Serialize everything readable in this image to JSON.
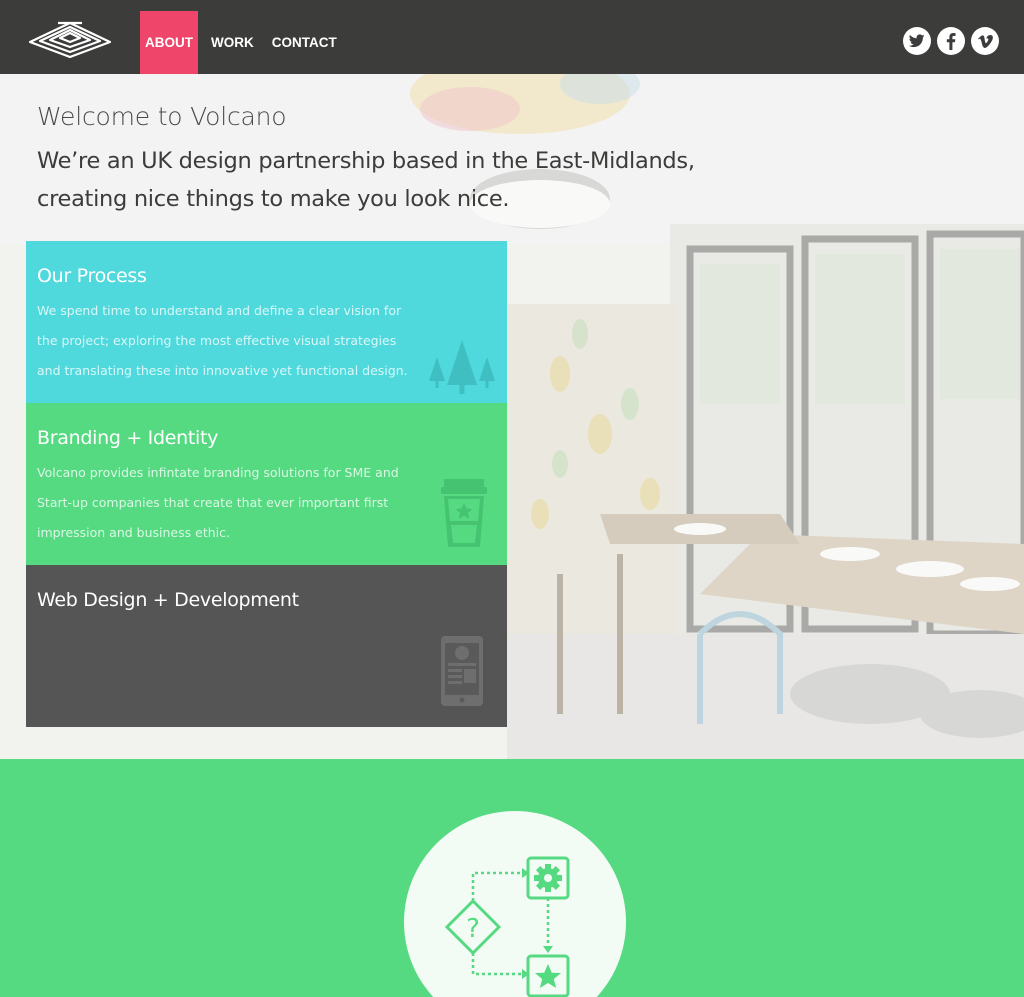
{
  "nav": {
    "items": [
      {
        "label": "ABOUT",
        "active": true
      },
      {
        "label": "WORK",
        "active": false
      },
      {
        "label": "CONTACT",
        "active": false
      }
    ]
  },
  "social": [
    "twitter-icon",
    "facebook-icon",
    "vimeo-icon"
  ],
  "hero": {
    "welcome": "Welcome to Volcano",
    "tagline": "We’re an UK design partnership based in the East-Midlands, creating nice things to make you look nice."
  },
  "cards": {
    "process": {
      "title": "Our Process",
      "description": "We spend time to understand and define a clear vision for the project; exploring the most effective visual strategies and translating these into innovative yet functional design.",
      "icon": "trees-icon"
    },
    "branding": {
      "title": "Branding + Identity",
      "description": "Volcano provides infintate branding solutions for SME and Start-up companies that create that ever important first impression and business ethic.",
      "icon": "coffee-cup-icon"
    },
    "web": {
      "title": "Web Design + Development",
      "icon": "mobile-device-icon"
    }
  },
  "colors": {
    "header": "#3c3c3b",
    "accent": "#f0456b",
    "process": "#4fd9dd",
    "branding": "#55da82",
    "web": "#555555",
    "green_section": "#55da82"
  },
  "process_graphic": {
    "icon": "process-flowchart-icon",
    "question_glyph": "?"
  }
}
